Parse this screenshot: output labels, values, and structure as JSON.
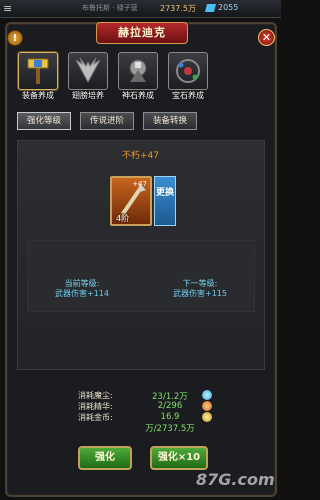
{
  "topbar": {
    "hint": "布鲁托斯 · 禄子营",
    "resource1": "2737.5万",
    "resource2": "2055"
  },
  "dialog": {
    "title": "赫拉迪克",
    "info_glyph": "!",
    "close_glyph": "✕"
  },
  "nurture_icons": [
    {
      "label": "装备养成",
      "icon": "hammer-icon",
      "active": true
    },
    {
      "label": "翅膀培养",
      "icon": "wings-icon",
      "active": false
    },
    {
      "label": "神石养成",
      "icon": "sacred-stone-icon",
      "active": false
    },
    {
      "label": "宝石养成",
      "icon": "gem-icon",
      "active": false
    }
  ],
  "tabs": [
    {
      "label": "强化等级",
      "active": true
    },
    {
      "label": "传说进阶",
      "active": false
    },
    {
      "label": "装备转换",
      "active": false
    }
  ],
  "item": {
    "name": "不朽+47",
    "level_badge": "4阶",
    "plus_badge": "+47",
    "change_label": "更换"
  },
  "current": {
    "title": "当前等级:",
    "value": "武器伤害+114"
  },
  "next": {
    "title": "下一等级:",
    "value": "武器伤害+115"
  },
  "costs": [
    {
      "label": "消耗魔尘:",
      "value": "23/1.2万",
      "icon": "dust-icon",
      "color": "#6cc9ef"
    },
    {
      "label": "消耗精华:",
      "value": "2/296",
      "icon": "essence-icon",
      "color": "#e59a2a"
    },
    {
      "label": "消耗金币:",
      "value": "16.9万/2737.5万",
      "icon": "gold-icon",
      "color": "#e8c36a"
    }
  ],
  "buttons": {
    "enhance": "强化",
    "enhance10": "强化×10"
  },
  "watermark": "87G.com"
}
